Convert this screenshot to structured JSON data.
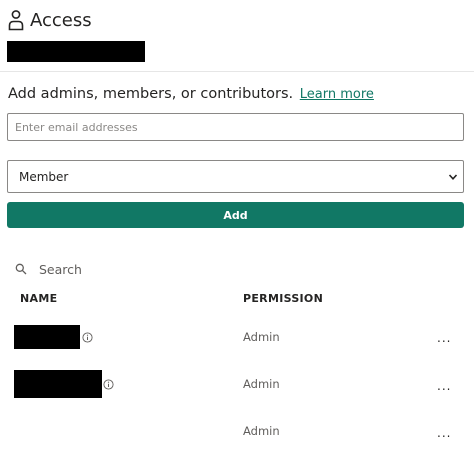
{
  "header": {
    "title": "Access",
    "icon": "person-icon"
  },
  "invite": {
    "prompt": "Add admins, members, or contributors.",
    "learn_more": "Learn more",
    "email_placeholder": "Enter email addresses",
    "role_selected": "Member",
    "add_label": "Add"
  },
  "search": {
    "label": "Search"
  },
  "table": {
    "columns": {
      "name": "NAME",
      "permission": "PERMISSION"
    },
    "rows": [
      {
        "permission": "Admin",
        "more": "..."
      },
      {
        "permission": "Admin",
        "more": "..."
      },
      {
        "permission": "Admin",
        "more": "..."
      }
    ]
  },
  "colors": {
    "accent": "#117865",
    "text": "#252423",
    "muted": "#605e5c",
    "border": "#8a8886"
  }
}
